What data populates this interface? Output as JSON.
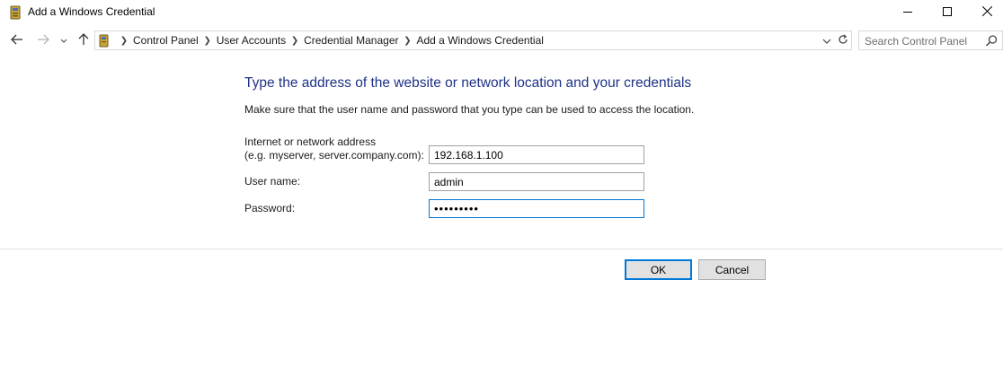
{
  "window": {
    "title": "Add a Windows Credential",
    "icon": "credential-manager-icon",
    "controls": [
      "minimize-icon",
      "maximize-icon",
      "close-icon"
    ]
  },
  "nav": {
    "back_icon": "back-arrow-icon",
    "forward_icon": "forward-arrow-icon",
    "recent_icon": "chevron-down-icon",
    "up_icon": "up-arrow-icon",
    "breadcrumbs": [
      "Control Panel",
      "User Accounts",
      "Credential Manager",
      "Add a Windows Credential"
    ],
    "separator": ">",
    "search_placeholder": "Search Control Panel"
  },
  "form": {
    "heading": "Type the address of the website or network location and your credentials",
    "instruction": "Make sure that the user name and password that you type can be used to access the location.",
    "address_label_line1": "Internet or network address",
    "address_label_line2": "(e.g. myserver, server.company.com):",
    "address_value": "192.168.1.100",
    "username_label": "User name:",
    "username_value": "admin",
    "password_label": "Password:",
    "password_value": "•••••••••"
  },
  "buttons": {
    "ok": "OK",
    "cancel": "Cancel"
  },
  "colors": {
    "heading": "#1e3287",
    "focus_border": "#0078d7",
    "button_face": "#e1e1e1"
  }
}
